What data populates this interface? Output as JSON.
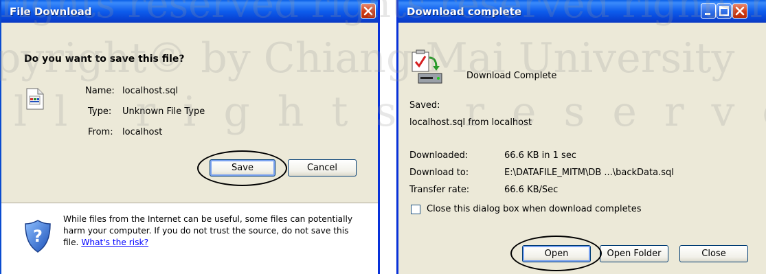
{
  "file_download": {
    "title": "File Download",
    "heading": "Do you want to save this file?",
    "name_label": "Name:",
    "name_value": "localhost.sql",
    "type_label": "Type:",
    "type_value": "Unknown File Type",
    "from_label": "From:",
    "from_value": "localhost",
    "save_button": "Save",
    "cancel_button": "Cancel",
    "warning_text_1": "While files from the Internet can be useful, some files can potentially",
    "warning_text_2": "harm your computer. If you do not trust the source, do not save this",
    "warning_text_3": "file.",
    "warning_link": "What's the risk?"
  },
  "download_complete": {
    "title": "Download complete",
    "status": "Download Complete",
    "saved_label": "Saved:",
    "saved_value": "localhost.sql from localhost",
    "downloaded_label": "Downloaded:",
    "downloaded_value": "66.6 KB in 1 sec",
    "download_to_label": "Download to:",
    "download_to_value": "E:\\DATAFILE_MITM\\DB ...\\backData.sql",
    "transfer_rate_label": "Transfer rate:",
    "transfer_rate_value": "66.6 KB/Sec",
    "close_checkbox_label": "Close this dialog box when download completes",
    "open_button": "Open",
    "open_folder_button": "Open Folder",
    "close_button": "Close"
  },
  "watermark": {
    "line1": "rights reserved   rights reserved   rights reserved",
    "line2": "pyright© by Chiang Mai University",
    "line3": "ll rights reserved"
  },
  "colors": {
    "titlebar": "#0a5ee6",
    "dialog_bg": "#ece9d8",
    "close_button": "#cf3a14",
    "link": "#0000ff"
  },
  "icons": [
    "file-icon",
    "shield-question-icon",
    "download-complete-icon",
    "close-icon",
    "minimize-icon",
    "maximize-icon"
  ]
}
